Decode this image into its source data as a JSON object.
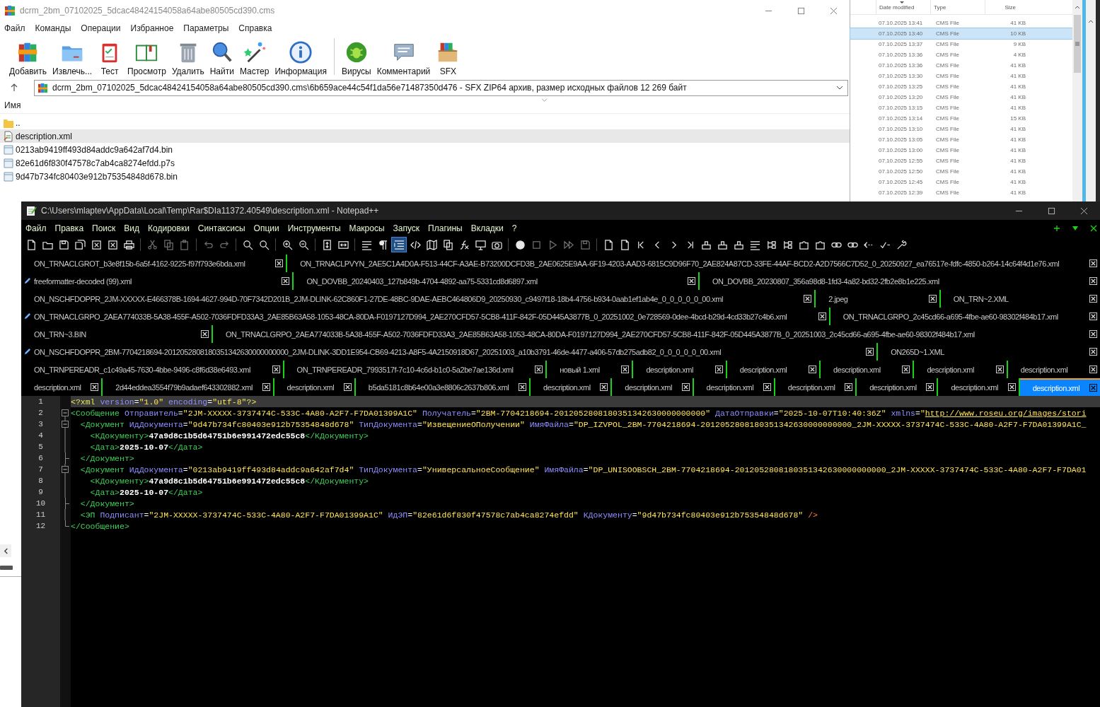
{
  "archiver": {
    "title": "dcrm_2bm_07102025_5dcac48424154058a64abe80505cd390.cms",
    "menu": [
      "Файл",
      "Команды",
      "Операции",
      "Избранное",
      "Параметры",
      "Справка"
    ],
    "toolbar": [
      {
        "label": "Добавить"
      },
      {
        "label": "Извлечь..."
      },
      {
        "label": "Тест"
      },
      {
        "label": "Просмотр"
      },
      {
        "label": "Удалить"
      },
      {
        "label": "Найти"
      },
      {
        "label": "Мастер"
      },
      {
        "label": "Информация"
      },
      {
        "label": "Вирусы"
      },
      {
        "label": "Комментарий"
      },
      {
        "label": "SFX"
      }
    ],
    "path": "dcrm_2bm_07102025_5dcac48424154058a64abe80505cd390.cms\\6b659ace44c54f1da56e71487350d476 - SFX ZIP64 архив, размер исходных файлов 12 269 байт",
    "name_column": "Имя",
    "files": [
      {
        "name": "..",
        "kind": "folder",
        "selected": false
      },
      {
        "name": "description.xml",
        "kind": "xml",
        "selected": true
      },
      {
        "name": "0213ab9419ff493d84addc9a642af7d4.bin",
        "kind": "file",
        "selected": false
      },
      {
        "name": "82e61d6f830f47578c7ab4ca8274efdd.p7s",
        "kind": "file",
        "selected": false
      },
      {
        "name": "9d47b734fc80403e912b75354848d678.bin",
        "kind": "file",
        "selected": false
      }
    ]
  },
  "explorer": {
    "columns": [
      "Date modified",
      "Type",
      "Size"
    ],
    "rows": [
      {
        "date": "07.10.2025 13:41",
        "type": "CMS File",
        "size": "41 KB",
        "selected": false
      },
      {
        "date": "07.10.2025 13:40",
        "type": "CMS File",
        "size": "10 KB",
        "selected": true
      },
      {
        "date": "07.10.2025 13:37",
        "type": "CMS File",
        "size": "9 KB",
        "selected": false
      },
      {
        "date": "07.10.2025 13:36",
        "type": "CMS File",
        "size": "4 KB",
        "selected": false
      },
      {
        "date": "07.10.2025 13:36",
        "type": "CMS File",
        "size": "41 KB",
        "selected": false
      },
      {
        "date": "07.10.2025 13:30",
        "type": "CMS File",
        "size": "41 KB",
        "selected": false
      },
      {
        "date": "07.10.2025 13:25",
        "type": "CMS File",
        "size": "41 KB",
        "selected": false
      },
      {
        "date": "07.10.2025 13:20",
        "type": "CMS File",
        "size": "41 KB",
        "selected": false
      },
      {
        "date": "07.10.2025 13:15",
        "type": "CMS File",
        "size": "41 KB",
        "selected": false
      },
      {
        "date": "07.10.2025 13:14",
        "type": "CMS File",
        "size": "15 KB",
        "selected": false
      },
      {
        "date": "07.10.2025 13:10",
        "type": "CMS File",
        "size": "41 KB",
        "selected": false
      },
      {
        "date": "07.10.2025 13:05",
        "type": "CMS File",
        "size": "41 KB",
        "selected": false
      },
      {
        "date": "07.10.2025 13:00",
        "type": "CMS File",
        "size": "41 KB",
        "selected": false
      },
      {
        "date": "07.10.2025 12:55",
        "type": "CMS File",
        "size": "41 KB",
        "selected": false
      },
      {
        "date": "07.10.2025 12:50",
        "type": "CMS File",
        "size": "41 KB",
        "selected": false
      },
      {
        "date": "07.10.2025 12:45",
        "type": "CMS File",
        "size": "41 KB",
        "selected": false
      },
      {
        "date": "07.10.2025 12:39",
        "type": "CMS File",
        "size": "41 KB",
        "selected": false
      }
    ]
  },
  "editor": {
    "title": "C:\\Users\\mlaptev\\AppData\\Local\\Temp\\Rar$DIa11372.40549\\description.xml - Notepad++",
    "menu": [
      "Файл",
      "Правка",
      "Поиск",
      "Вид",
      "Кодировки",
      "Синтаксисы",
      "Опции",
      "Инструменты",
      "Макросы",
      "Запуск",
      "Плагины",
      "Вкладки",
      "?"
    ],
    "toolbar": [
      {
        "on": false,
        "disabled": false
      },
      {
        "on": false,
        "disabled": false
      },
      {
        "on": false,
        "disabled": false
      },
      {
        "on": false,
        "disabled": false
      },
      {
        "on": false,
        "disabled": false
      },
      {
        "on": false,
        "disabled": false
      },
      {
        "on": false,
        "disabled": false
      },
      {
        "on": false,
        "disabled": true
      },
      {
        "on": false,
        "disabled": true
      },
      {
        "on": false,
        "disabled": true
      },
      {
        "on": false,
        "disabled": true
      },
      {
        "on": false,
        "disabled": true
      },
      {
        "on": false,
        "disabled": false
      },
      {
        "on": false,
        "disabled": false
      },
      {
        "on": false,
        "disabled": false
      },
      {
        "on": false,
        "disabled": false
      },
      {
        "on": false,
        "disabled": false
      },
      {
        "on": false,
        "disabled": false
      },
      {
        "on": false,
        "disabled": false
      },
      {
        "on": false,
        "disabled": false
      },
      {
        "on": true,
        "disabled": false
      },
      {
        "on": false,
        "disabled": false
      },
      {
        "on": false,
        "disabled": false
      },
      {
        "on": false,
        "disabled": false
      },
      {
        "on": false,
        "disabled": false
      },
      {
        "on": false,
        "disabled": false
      },
      {
        "on": false,
        "disabled": false
      },
      {
        "on": false,
        "disabled": false
      },
      {
        "on": false,
        "disabled": true
      },
      {
        "on": false,
        "disabled": true
      },
      {
        "on": false,
        "disabled": true
      },
      {
        "on": false,
        "disabled": true
      },
      {
        "on": false,
        "disabled": false
      },
      {
        "on": false,
        "disabled": false
      },
      {
        "on": false,
        "disabled": false
      },
      {
        "on": false,
        "disabled": false
      },
      {
        "on": false,
        "disabled": false
      },
      {
        "on": false,
        "disabled": false
      },
      {
        "on": false,
        "disabled": false
      },
      {
        "on": false,
        "disabled": false
      },
      {
        "on": false,
        "disabled": false
      },
      {
        "on": false,
        "disabled": false
      },
      {
        "on": false,
        "disabled": false
      },
      {
        "on": false,
        "disabled": false
      },
      {
        "on": false,
        "disabled": false
      },
      {
        "on": false,
        "disabled": false
      },
      {
        "on": false,
        "disabled": false
      },
      {
        "on": false,
        "disabled": false
      },
      {
        "on": false,
        "disabled": false
      },
      {
        "on": false,
        "disabled": false
      },
      {
        "on": false,
        "disabled": false
      }
    ],
    "tab_rows": [
      {
        "tabs": [
          {
            "label": "ON_TRNACLGROT_b3e8f15b-6a5f-4162-9225-f97f793e6bda.xml",
            "modified": false,
            "selected": false
          },
          {
            "label": "ON_TRNACLPVYN_2AE5C1A4D0A-F513-44CF-A3AE-B73200DCFD3B_2AE0625E9AA-6F19-4203-AAD3-6815C9D96F70_2AE824A87CD-33FE-44AF-BCD2-A2D7566C7D52_0_20250927_ea76517e-fdfc-4850-b264-14c64f4d1e76.xml",
            "modified": false,
            "selected": false
          }
        ]
      },
      {
        "tabs": [
          {
            "label": "freeformatter-decoded (99).xml",
            "modified": true,
            "selected": false
          },
          {
            "label": "ON_DOVBB_20240403_127b849b-4704-4892-aa75-5331cd8d6897.xml",
            "modified": false,
            "selected": false
          },
          {
            "label": "ON_DOVBB_20230807_356a98d8-1fd3-4a82-bd32-2fb2e8b1e225.xml",
            "modified": false,
            "selected": false
          }
        ]
      },
      {
        "tabs": [
          {
            "label": "ON_NSCHFDOPPR_2JM-XXXXX-E466378B-1694-4627-994D-70F7342D201B_2JM-DLINK-62C860F1-27DE-48BC-9DAE-AEBC464806D9_20250930_c9497f18-18b4-4756-b934-0aab1ef1ab4e_0_0_0_0_0_00.xml",
            "modified": false,
            "selected": false
          },
          {
            "label": "2.jpeg",
            "modified": false,
            "selected": false
          },
          {
            "label": "ON_TRN~2.XML",
            "modified": false,
            "selected": false
          }
        ]
      },
      {
        "tabs": [
          {
            "label": "ON_TRNACLGRPO_2AEA774033B-5A38-455F-A502-7036FDFD33A3_2AE85B63A58-1053-48CA-80DA-F0197127D994_2AE270CFD57-5CB8-411F-842F-05D445A3877B_0_20251002_0e728569-0dee-4bcd-b29d-4cd33b27c4b6.xml",
            "modified": true,
            "selected": false
          },
          {
            "label": "ON_TRNACLGRPO_2c45cd66-a695-4fbe-ae60-98302f484b17.xml",
            "modified": false,
            "selected": false
          }
        ]
      },
      {
        "tabs": [
          {
            "label": "ON_TRN~3.BIN",
            "modified": false,
            "selected": false
          },
          {
            "label": "ON_TRNACLGRPO_2AEA774033B-5A38-455F-A502-7036FDFD33A3_2AE85B63A58-1053-48CA-80DA-F0197127D994_2AE270CFD57-5CB8-411F-842F-05D445A3877B_0_20251003_2c45cd66-a695-4fbe-ae60-98302f484b17.xml",
            "modified": false,
            "selected": false
          }
        ]
      },
      {
        "tabs": [
          {
            "label": "ON_NSCHFDOPPR_2BM-7704218694-2012052808180351342630000000000_2JM-DLINK-3DD1E954-CB69-4213-A8F5-4A2150918D67_20251003_a10b3791-46de-4477-a406-57db275adb82_0_0_0_0_0_00.xml",
            "modified": true,
            "selected": false
          },
          {
            "label": "ON265D~1.XML",
            "modified": false,
            "selected": false
          }
        ]
      },
      {
        "tabs": [
          {
            "label": "ON_TRNPEREADR_c1c49a45-7630-4bbe-9496-c8f6d38e6493.xml",
            "modified": false,
            "selected": false
          },
          {
            "label": "ON_TRNPEREADR_7993517f-7c10-4c6d-b1c0-5a2be7ae136d.xml",
            "modified": false,
            "selected": false
          },
          {
            "label": "новый 1.xml",
            "modified": false,
            "selected": false
          },
          {
            "label": "description.xml",
            "modified": false,
            "selected": false
          },
          {
            "label": "description.xml",
            "modified": false,
            "selected": false
          },
          {
            "label": "description.xml",
            "modified": false,
            "selected": false
          },
          {
            "label": "description.xml",
            "modified": false,
            "selected": false
          },
          {
            "label": "description.xml",
            "modified": false,
            "selected": false
          }
        ]
      },
      {
        "tabs": [
          {
            "label": "description.xml",
            "modified": false,
            "selected": false
          },
          {
            "label": "2d44eddea3554f79b9adaef643302882.xml",
            "modified": false,
            "selected": false
          },
          {
            "label": "description.xml",
            "modified": false,
            "selected": false
          },
          {
            "label": "b5da5181c8b64e00a3e8806c2637b806.xml",
            "modified": false,
            "selected": false
          },
          {
            "label": "description.xml",
            "modified": false,
            "selected": false
          },
          {
            "label": "description.xml",
            "modified": false,
            "selected": false
          },
          {
            "label": "description.xml",
            "modified": false,
            "selected": false
          },
          {
            "label": "description.xml",
            "modified": false,
            "selected": false
          },
          {
            "label": "description.xml",
            "modified": false,
            "selected": false
          },
          {
            "label": "description.xml",
            "modified": false,
            "selected": false
          },
          {
            "label": "description.xml",
            "modified": false,
            "selected": true
          }
        ]
      }
    ],
    "lines": [
      {
        "number": "1",
        "current": true,
        "kind": "plain",
        "tokens": [
          {
            "kind": "decl",
            "text": "<?xml"
          },
          {
            "kind": "attr",
            "text": " version"
          },
          {
            "kind": "eq",
            "text": "="
          },
          {
            "kind": "value",
            "text": "\"1.0\""
          },
          {
            "kind": "attr",
            "text": " encoding"
          },
          {
            "kind": "eq",
            "text": "="
          },
          {
            "kind": "value",
            "text": "\"utf-8\""
          },
          {
            "kind": "decl",
            "text": "?>"
          }
        ]
      },
      {
        "number": "2",
        "current": false,
        "kind": "fold-start",
        "tokens": [
          {
            "kind": "tag",
            "text": "<Сообщение"
          },
          {
            "kind": "attr",
            "text": " Отправитель"
          },
          {
            "kind": "eq",
            "text": "="
          },
          {
            "kind": "value",
            "text": "\"2JM-XXXXX-3737474C-533C-4A80-A2F7-F7DA01399A1C\""
          },
          {
            "kind": "attr",
            "text": " Получатель"
          },
          {
            "kind": "eq",
            "text": "="
          },
          {
            "kind": "value",
            "text": "\"2BM-7704218694-2012052808180351342630000000000\""
          },
          {
            "kind": "attr",
            "text": " ДатаОтправки"
          },
          {
            "kind": "eq",
            "text": "="
          },
          {
            "kind": "value",
            "text": "\"2025-10-07T10:40:36Z\""
          },
          {
            "kind": "attr",
            "text": " xmlns"
          },
          {
            "kind": "eq",
            "text": "="
          },
          {
            "kind": "value",
            "text": "\""
          },
          {
            "kind": "link",
            "text": "http://www.roseu.org/images/stori"
          }
        ]
      },
      {
        "number": "3",
        "current": false,
        "kind": "fold-start",
        "tokens": [
          {
            "kind": "tag",
            "text": "  <Документ"
          },
          {
            "kind": "attr",
            "text": " ИдДокумента"
          },
          {
            "kind": "eq",
            "text": "="
          },
          {
            "kind": "value",
            "text": "\"9d47b734fc80403e912b75354848d678\""
          },
          {
            "kind": "attr",
            "text": " ТипДокумента"
          },
          {
            "kind": "eq",
            "text": "="
          },
          {
            "kind": "value",
            "text": "\"ИзвещениеОПолучении\""
          },
          {
            "kind": "attr",
            "text": " ИмяФайла"
          },
          {
            "kind": "eq",
            "text": "="
          },
          {
            "kind": "value",
            "text": "\"DP_IZVPOL_2BM-7704218694-2012052808180351342630000000000_2JM-XXXXX-3737474C-533C-4A80-A2F7-F7DA01399A1C_"
          }
        ]
      },
      {
        "number": "4",
        "current": false,
        "kind": "fold-body",
        "tokens": [
          {
            "kind": "tag",
            "text": "    <КДокументу>"
          },
          {
            "kind": "text",
            "text": "47a9d8c1b5d64751b6e991472edc55c8"
          },
          {
            "kind": "tag",
            "text": "</КДокументу>"
          }
        ]
      },
      {
        "number": "5",
        "current": false,
        "kind": "fold-body",
        "tokens": [
          {
            "kind": "tag",
            "text": "    <Дата>"
          },
          {
            "kind": "text",
            "text": "2025-10-07"
          },
          {
            "kind": "tag",
            "text": "</Дата>"
          }
        ]
      },
      {
        "number": "6",
        "current": false,
        "kind": "fold-end",
        "tokens": [
          {
            "kind": "tag",
            "text": "  </Документ>"
          }
        ]
      },
      {
        "number": "7",
        "current": false,
        "kind": "fold-start",
        "tokens": [
          {
            "kind": "tag",
            "text": "  <Документ"
          },
          {
            "kind": "attr",
            "text": " ИдДокумента"
          },
          {
            "kind": "eq",
            "text": "="
          },
          {
            "kind": "value",
            "text": "\"0213ab9419ff493d84addc9a642af7d4\""
          },
          {
            "kind": "attr",
            "text": " ТипДокумента"
          },
          {
            "kind": "eq",
            "text": "="
          },
          {
            "kind": "value",
            "text": "\"УниверсальноеСообщение\""
          },
          {
            "kind": "attr",
            "text": " ИмяФайла"
          },
          {
            "kind": "eq",
            "text": "="
          },
          {
            "kind": "value",
            "text": "\"DP_UNISOOBSCH_2BM-7704218694-2012052808180351342630000000000_2JM-XXXXX-3737474C-533C-4A80-A2F7-F7DA01"
          }
        ]
      },
      {
        "number": "8",
        "current": false,
        "kind": "fold-body",
        "tokens": [
          {
            "kind": "tag",
            "text": "    <КДокументу>"
          },
          {
            "kind": "text",
            "text": "47a9d8c1b5d64751b6e991472edc55c8"
          },
          {
            "kind": "tag",
            "text": "</КДокументу>"
          }
        ]
      },
      {
        "number": "9",
        "current": false,
        "kind": "fold-body",
        "tokens": [
          {
            "kind": "tag",
            "text": "    <Дата>"
          },
          {
            "kind": "text",
            "text": "2025-10-07"
          },
          {
            "kind": "tag",
            "text": "</Дата>"
          }
        ]
      },
      {
        "number": "10",
        "current": false,
        "kind": "fold-end",
        "tokens": [
          {
            "kind": "tag",
            "text": "  </Документ>"
          }
        ]
      },
      {
        "number": "11",
        "current": false,
        "kind": "fold-body",
        "tokens": [
          {
            "kind": "tag",
            "text": "  <ЭП"
          },
          {
            "kind": "attr",
            "text": " Подписант"
          },
          {
            "kind": "eq",
            "text": "="
          },
          {
            "kind": "value",
            "text": "\"2JM-XXXXX-3737474C-533C-4A80-A2F7-F7DA01399A1C\""
          },
          {
            "kind": "attr",
            "text": " ИдЭП"
          },
          {
            "kind": "eq",
            "text": "="
          },
          {
            "kind": "value",
            "text": "\"82e61d6f830f47578c7ab4ca8274efdd\""
          },
          {
            "kind": "attr",
            "text": " КДокументу"
          },
          {
            "kind": "eq",
            "text": "="
          },
          {
            "kind": "value",
            "text": "\"9d47b734fc80403e912b75354848d678\""
          },
          {
            "kind": "end",
            "text": " />"
          }
        ]
      },
      {
        "number": "12",
        "current": false,
        "kind": "fold-end",
        "tokens": [
          {
            "kind": "tag",
            "text": "</Сообщение>"
          }
        ]
      }
    ]
  }
}
